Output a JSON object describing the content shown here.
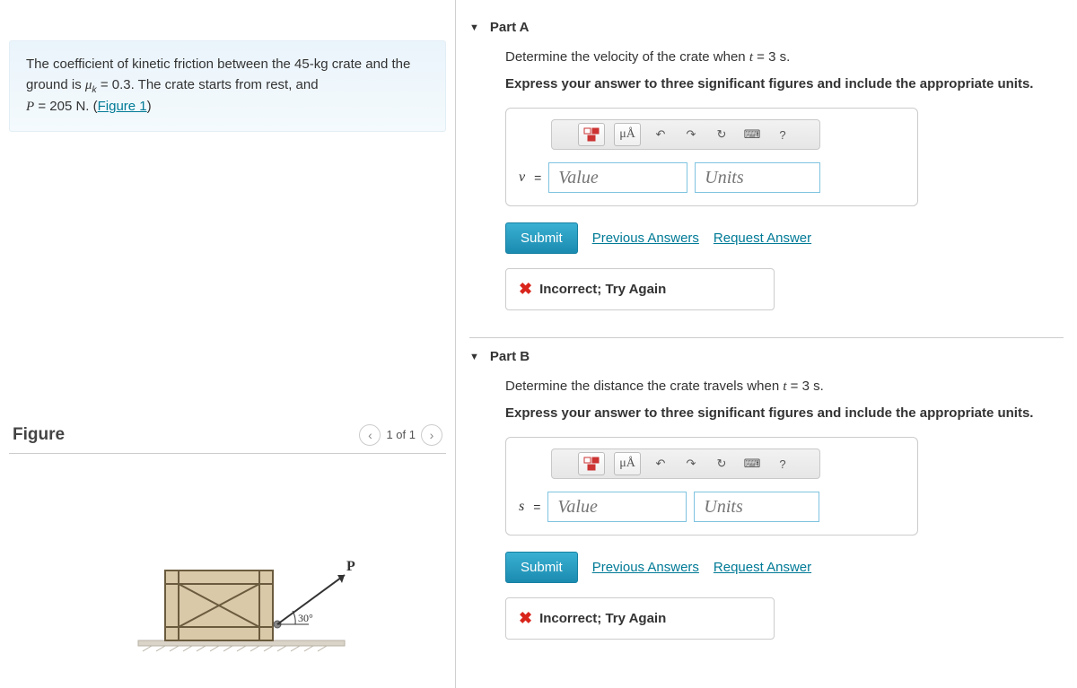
{
  "problem": {
    "text_pre": "The coefficient of kinetic friction between the 45-kg crate and the ground is ",
    "muk_label": "μ",
    "muk_sub": "k",
    "muk_eq": " = 0.3. The crate starts from rest, and ",
    "p_label": "P",
    "p_eq": " = 205 N. (",
    "figure_link": "Figure 1",
    "close": ")"
  },
  "figure": {
    "title": "Figure",
    "counter": "1 of 1",
    "force_label": "P",
    "angle_label": "30°"
  },
  "parts": [
    {
      "id": "A",
      "title": "Part A",
      "instruction_pre": "Determine the velocity of the crate when ",
      "instruction_t": "t",
      "instruction_post": " = 3 s.",
      "format": "Express your answer to three significant figures and include the appropriate units.",
      "var": "v",
      "eq": " =",
      "value_ph": "Value",
      "units_ph": "Units",
      "toolbar": {
        "units": "μÅ",
        "help": "?"
      },
      "submit": "Submit",
      "previous": "Previous Answers",
      "request": "Request Answer",
      "feedback": "Incorrect; Try Again"
    },
    {
      "id": "B",
      "title": "Part B",
      "instruction_pre": "Determine the distance the crate travels when ",
      "instruction_t": "t",
      "instruction_post": " = 3 s.",
      "format": "Express your answer to three significant figures and include the appropriate units.",
      "var": "s",
      "eq": " =",
      "value_ph": "Value",
      "units_ph": "Units",
      "toolbar": {
        "units": "μÅ",
        "help": "?"
      },
      "submit": "Submit",
      "previous": "Previous Answers",
      "request": "Request Answer",
      "feedback": "Incorrect; Try Again"
    }
  ]
}
